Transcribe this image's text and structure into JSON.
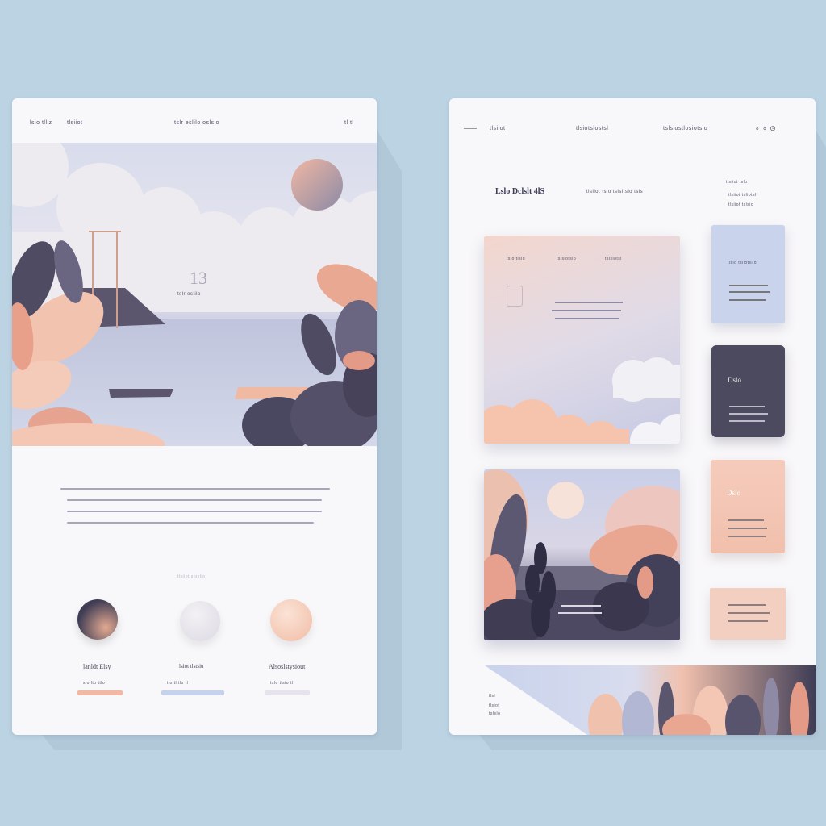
{
  "left_page": {
    "nav": {
      "left": "lsio tlliz",
      "left2": "tlsiiot",
      "center": "tslr eslilo oslslo",
      "right": "tl tl"
    },
    "hero": {
      "number": "13",
      "caption": "tslr eslilo"
    },
    "features": [
      {
        "title": "lanldt Elsy",
        "button": "slo lto ttlo"
      },
      {
        "title": "lsiot tlstsiu",
        "button": "tlo tl tlo tl"
      },
      {
        "title": "Alsoslstysiout",
        "button": "tslo tlsio tl"
      }
    ],
    "section_label": "tlsiiot slostlo"
  },
  "right_page": {
    "nav": {
      "item1": "tlsiiot",
      "item2": "tlsiotslostsl",
      "item3": "tslslostlosiotslo",
      "icons": "∘ ∘ ⊙"
    },
    "brand": "Lslo Dclslt 4lS",
    "tagline": "tlsiiot tslo tslsitslo tsls",
    "right_meta": [
      "tlsiiot tslo",
      "tlsiiot tsliotsl",
      "tlsiiot tslsio"
    ],
    "feature_card": {
      "labels": [
        "tslo  tlslo",
        "tslsiotslo",
        "tslsiotsl"
      ]
    },
    "side_cards": [
      {
        "title": "tlslo tsliotsilo"
      },
      {
        "title": "Dslo"
      },
      {
        "title": "Dslo"
      }
    ],
    "bottom_text": [
      "tlsi",
      "tlsiot",
      "tslslo"
    ]
  },
  "colors": {
    "background": "#bcd3e3",
    "peach": "#f1c3b0",
    "navy": "#4a4a5e",
    "lavender": "#c8d2ea",
    "card": "#f8f7f9"
  },
  "icons": [
    "sun-icon",
    "circle-icon",
    "plant-icon",
    "cloud-icon"
  ]
}
